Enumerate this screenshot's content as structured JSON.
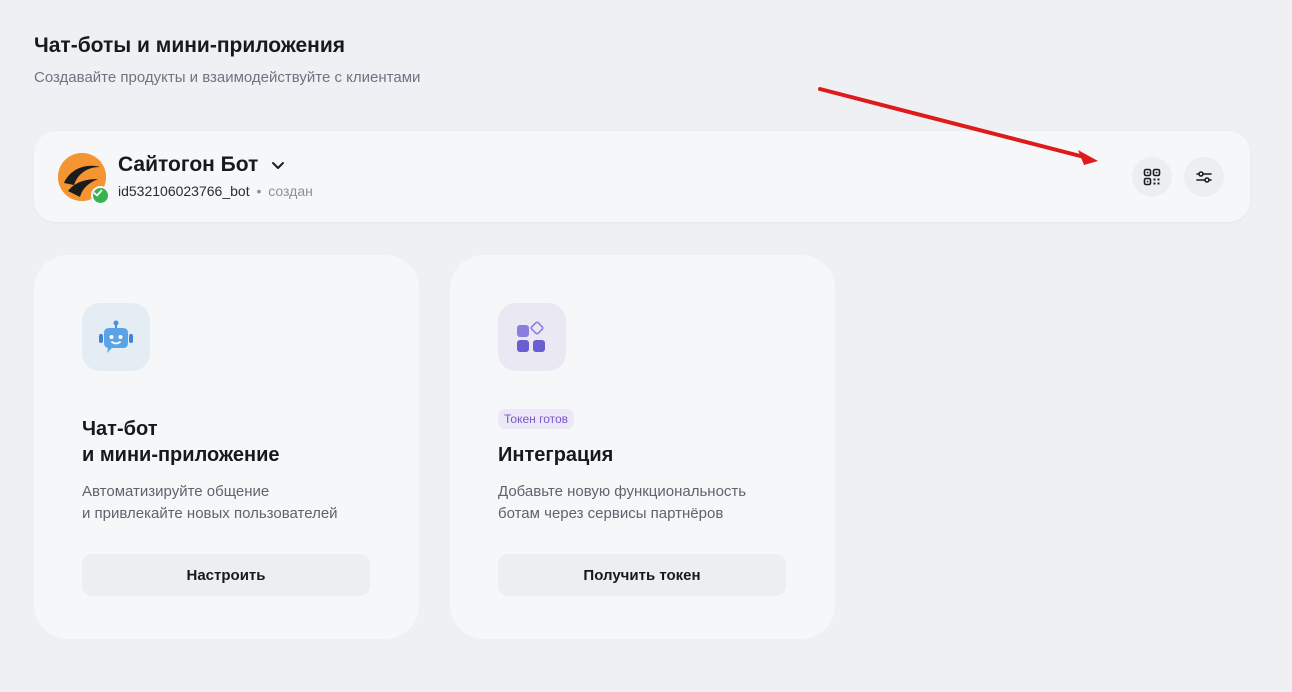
{
  "page": {
    "title": "Чат-боты и мини-приложения",
    "subtitle": "Создавайте продукты и взаимодействуйте с клиентами"
  },
  "bot": {
    "name": "Сайтогон Бот",
    "username": "id532106023766_bot",
    "separator": "•",
    "status": "создан",
    "avatar_color": "#f59432",
    "verified_color": "#35b34e",
    "icons": [
      "qr-code-icon",
      "sliders-icon",
      "chevron-down-icon",
      "check-icon"
    ]
  },
  "cards": [
    {
      "icon": "chatbot-icon",
      "title_line1": "Чат-бот",
      "title_line2": "и мини-приложение",
      "desc_line1": "Автоматизируйте общение",
      "desc_line2": "и привлекайте новых пользователей",
      "button": "Настроить"
    },
    {
      "icon": "apps-grid-icon",
      "badge": "Токен готов",
      "title": "Интеграция",
      "desc_line1": "Добавьте новую функциональность",
      "desc_line2": "ботам через сервисы партнёров",
      "button": "Получить токен"
    }
  ],
  "annotation_arrow_color": "#e01a1a"
}
